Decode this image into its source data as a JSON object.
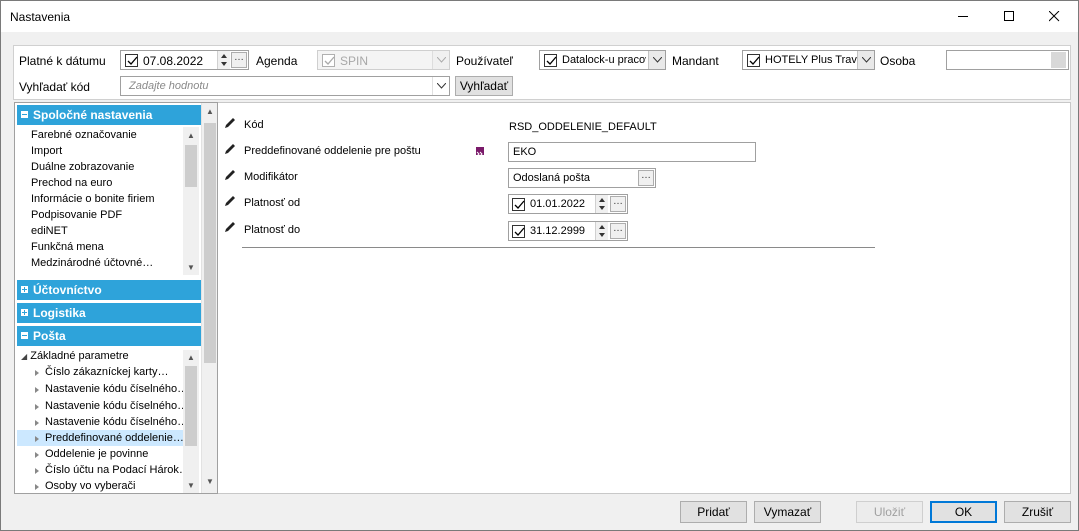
{
  "window": {
    "title": "Nastavenia"
  },
  "top": {
    "platne_label": "Platné k dátumu",
    "platne_date": "07.08.2022",
    "agenda_label": "Agenda",
    "agenda_value": "SPIN",
    "pouzivatel_label": "Používateľ",
    "pouzivatel_value": "Datalock-u pracov",
    "mandant_label": "Mandant",
    "mandant_value": "HOTELY Plus Trave",
    "osoba_label": "Osoba",
    "osoba_value": "",
    "vyhladat_label": "Vyhľadať kód",
    "vyhladat_placeholder": "Zadajte hodnotu",
    "vyhladat_button": "Vyhľadať"
  },
  "sections": {
    "spolocne": {
      "title": "Spoločné nastavenia",
      "items": [
        "Farebné označovanie",
        "Import",
        "Duálne zobrazovanie",
        "Prechod na euro",
        "Informácie o bonite firiem",
        "Podpisovanie PDF",
        "ediNET",
        "Funkčná mena",
        "Medzinárodné  účtovné…"
      ]
    },
    "uctovnictvo": {
      "title": "Účtovníctvo"
    },
    "logistika": {
      "title": "Logistika"
    },
    "posta": {
      "title": "Pošta",
      "root": "Základné parametre",
      "items": [
        "Číslo zákazníckej karty…",
        "Nastavenie  kódu  číselného…",
        "Nastavenie  kódu  číselného…",
        "Nastavenie  kódu  číselného…",
        "Preddefinované  oddelenie…",
        "Oddelenie je povinne",
        "Číslo účtu na Podací Hárok…",
        "Osoby vo vyberači"
      ]
    }
  },
  "detail": {
    "kod_label": "Kód",
    "kod_value": "RSD_ODDELENIE_DEFAULT",
    "pred_label": "Preddefinované oddelenie pre poštu",
    "pred_value": "EKO",
    "modif_label": "Modifikátor",
    "modif_value": "Odoslaná pošta",
    "od_label": "Platnosť od",
    "od_value": "01.01.2022",
    "do_label": "Platnosť do",
    "do_value": "31.12.2999"
  },
  "buttons": {
    "pridat": "Pridať",
    "vymazat": "Vymazať",
    "ulozit": "Uložiť",
    "ok": "OK",
    "zrusit": "Zrušiť"
  },
  "colors": {
    "section_header": "#2ea3da",
    "selected_row": "#cce8ff",
    "ok_border": "#0078d7"
  }
}
